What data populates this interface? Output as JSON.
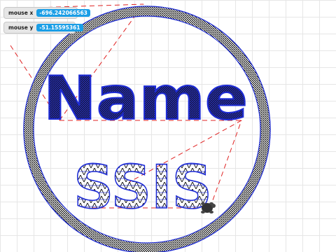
{
  "monitors": {
    "mouse_x": {
      "label": "mouse x",
      "value": "-696.242066563"
    },
    "mouse_y": {
      "label": "mouse y",
      "value": "-51.15595361"
    }
  },
  "drawing": {
    "name_text": "Name",
    "initials_text": "SSIS",
    "colors": {
      "stitch_black": "#111111",
      "stitch_blue": "#1d2bd6",
      "jump_red": "#e02424",
      "grid": "#e6e6e6"
    }
  },
  "icons": {
    "turtle_sprite": "turtle-icon"
  }
}
